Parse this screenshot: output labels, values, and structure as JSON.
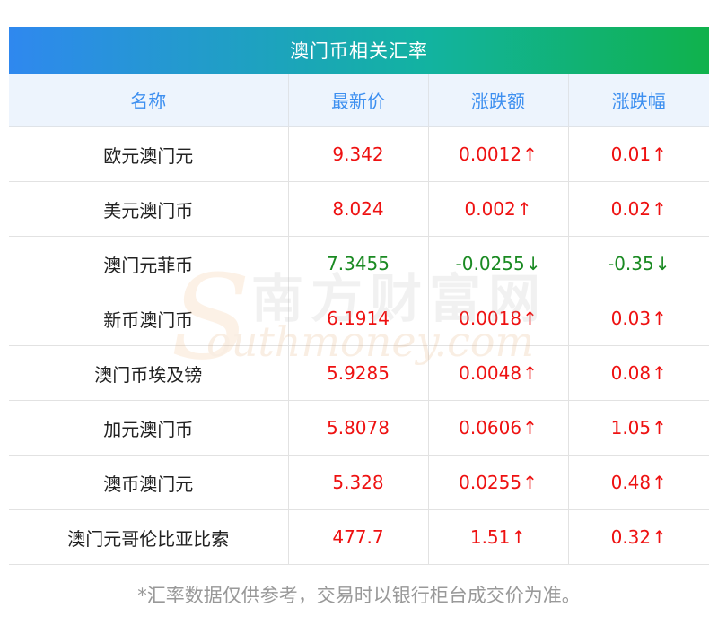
{
  "title": "澳门币相关汇率",
  "headers": {
    "name": "名称",
    "price": "最新价",
    "change": "涨跌额",
    "pct": "涨跌幅"
  },
  "rows": [
    {
      "name": "欧元澳门元",
      "price": "9.342",
      "change": "0.0012",
      "pct": "0.01",
      "dir": "up",
      "arrow": "↑"
    },
    {
      "name": "美元澳门币",
      "price": "8.024",
      "change": "0.002",
      "pct": "0.02",
      "dir": "up",
      "arrow": "↑"
    },
    {
      "name": "澳门元菲币",
      "price": "7.3455",
      "change": "-0.0255",
      "pct": "-0.35",
      "dir": "down",
      "arrow": "↓"
    },
    {
      "name": "新币澳门币",
      "price": "6.1914",
      "change": "0.0018",
      "pct": "0.03",
      "dir": "up",
      "arrow": "↑"
    },
    {
      "name": "澳门币埃及镑",
      "price": "5.9285",
      "change": "0.0048",
      "pct": "0.08",
      "dir": "up",
      "arrow": "↑"
    },
    {
      "name": "加元澳门币",
      "price": "5.8078",
      "change": "0.0606",
      "pct": "1.05",
      "dir": "up",
      "arrow": "↑"
    },
    {
      "name": "澳币澳门元",
      "price": "5.328",
      "change": "0.0255",
      "pct": "0.48",
      "dir": "up",
      "arrow": "↑"
    },
    {
      "name": "澳门元哥伦比亚比索",
      "price": "477.7",
      "change": "1.51",
      "pct": "0.32",
      "dir": "up",
      "arrow": "↑"
    }
  ],
  "footnote": "*汇率数据仅供参考，交易时以银行柜台成交价为准。",
  "watermark": {
    "cn": "南方财富网",
    "en": "outhmoney.com",
    "s": "S"
  },
  "colors": {
    "up": "#ee1111",
    "down": "#1a8a22",
    "header_text": "#3d8ff0",
    "title_gradient_start": "#2f88ef",
    "title_gradient_end": "#10b24c"
  }
}
